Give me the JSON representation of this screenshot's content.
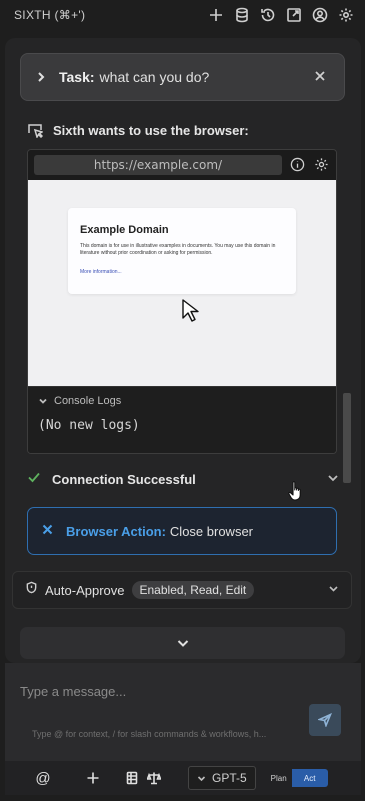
{
  "header": {
    "title": "SIXTH (⌘+')",
    "icons": [
      "plus-icon",
      "database-icon",
      "history-icon",
      "popout-icon",
      "account-icon",
      "settings-icon"
    ]
  },
  "task": {
    "label": "Task:",
    "text": "what can you do?"
  },
  "browser": {
    "heading": "Sixth wants to use the browser:",
    "url": "https://example.com/",
    "page": {
      "title": "Example Domain",
      "body": "This domain is for use in illustrative examples in documents. You may use this domain in literature without prior coordination or asking for permission.",
      "link": "More information..."
    },
    "console_label": "Console Logs",
    "console_text": "(No new logs)"
  },
  "connection": {
    "status": "Connection Successful"
  },
  "browser_action": {
    "label": "Browser Action:",
    "text": "Close browser"
  },
  "auto_approve": {
    "label": "Auto-Approve",
    "tags": "Enabled,  Read,  Edit"
  },
  "composer": {
    "placeholder": "Type a message...",
    "hint": "Type @ for context, / for slash commands & workflows, h..."
  },
  "bottombar": {
    "at_symbol": "@",
    "model": "GPT-5",
    "plan": "Plan",
    "act": "Act"
  },
  "colors": {
    "accent": "#4a9fe8",
    "success": "#5fb35f",
    "act_active": "#2a5da8"
  }
}
